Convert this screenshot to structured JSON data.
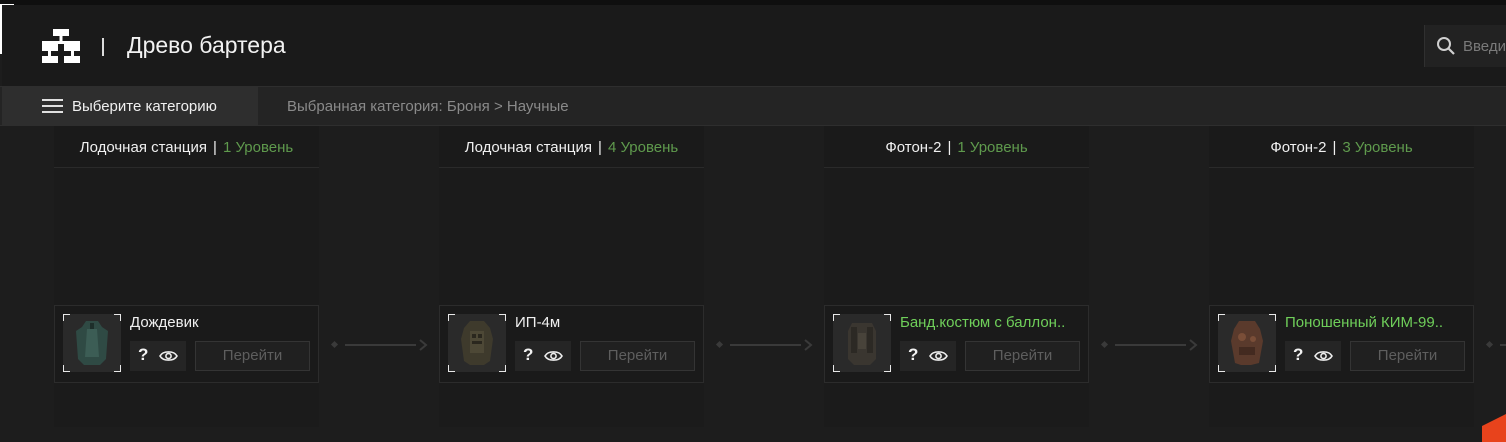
{
  "header": {
    "title": "Древо бартера",
    "search_placeholder": "Введи",
    "logo_icon": "tree-diagram-icon"
  },
  "categorybar": {
    "button_label": "Выберите категорию",
    "breadcrumb": "Выбранная категория: Броня > Научные"
  },
  "columns": [
    {
      "location": "Лодочная станция",
      "level": "1 Уровень",
      "item": {
        "name": "Дождевик",
        "highlight": false,
        "color": "#2f4a44"
      },
      "help": "?",
      "goto": "Перейти"
    },
    {
      "location": "Лодочная станция",
      "level": "4 Уровень",
      "item": {
        "name": "ИП-4м",
        "highlight": false,
        "color": "#3e3a2c"
      },
      "help": "?",
      "goto": "Перейти"
    },
    {
      "location": "Фотон-2",
      "level": "1 Уровень",
      "item": {
        "name": "Банд.костюм с баллон..",
        "highlight": true,
        "color": "#3a3630"
      },
      "help": "?",
      "goto": "Перейти"
    },
    {
      "location": "Фотон-2",
      "level": "3 Уровень",
      "item": {
        "name": "Поношенный КИМ-99..",
        "highlight": true,
        "color": "#5a3a2c"
      },
      "help": "?",
      "goto": "Перейти"
    }
  ],
  "colors": {
    "level_green": "#5f9a4d",
    "highlight_green": "#6fcf5a",
    "accent_orange": "#e8431c"
  }
}
